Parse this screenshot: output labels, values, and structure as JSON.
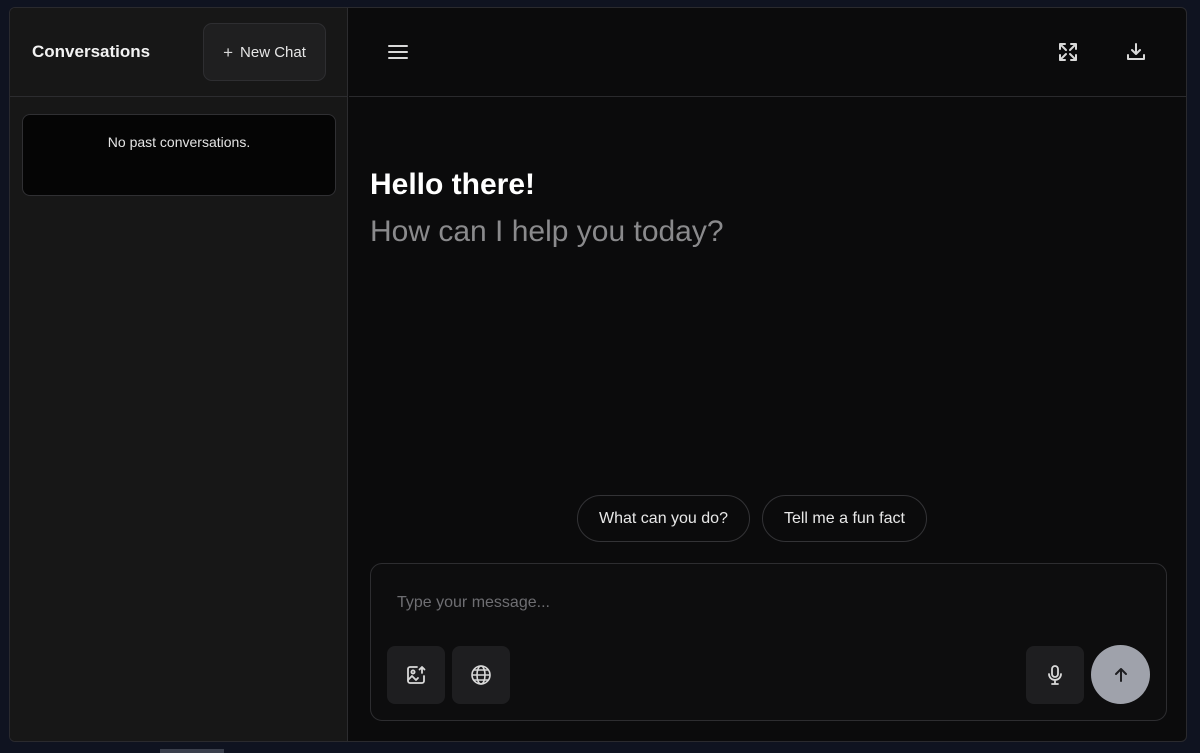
{
  "sidebar": {
    "title": "Conversations",
    "new_chat_label": "New Chat",
    "empty_message": "No past conversations."
  },
  "topbar": {
    "icons": [
      "menu-icon",
      "expand-icon",
      "download-icon"
    ]
  },
  "main": {
    "greeting": "Hello there!",
    "subgreeting": "How can I help you today?",
    "suggestions": [
      "What can you do?",
      "Tell me a fun fact"
    ]
  },
  "composer": {
    "placeholder": "Type your message...",
    "value": "",
    "icons": [
      "image-upload-icon",
      "globe-icon",
      "microphone-icon",
      "arrow-up-icon"
    ]
  },
  "colors": {
    "background": "#0b0b0c",
    "sidebar": "#171717",
    "send_button": "#9fa2ab",
    "muted_text": "#8a8a8c"
  }
}
